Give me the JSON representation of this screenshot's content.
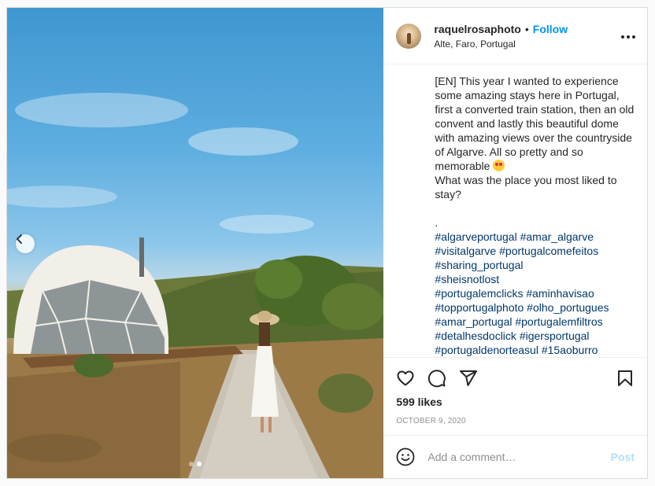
{
  "post": {
    "username": "raquelrosaphoto",
    "separator": "•",
    "follow_label": "Follow",
    "location": "Alte, Faro, Portugal",
    "more_icon": "more-options-icon",
    "caption": {
      "body": "[EN] This year I wanted to experience some amazing stays here in Portugal, first a converted train station, then an old convent and lastly this beautiful dome with amazing views over the countryside of Algarve. All so pretty and so memorable",
      "question": "What was the place you most liked to stay?",
      "dot": ".",
      "hashtags": [
        "#algarveportugal",
        "#amar_algarve",
        "#visitalgarve",
        "#portugalcomefeitos",
        "#sharing_portugal",
        "#sheisnotlost",
        "#portugalemclicks",
        "#aminhavisao",
        "#topportugalphoto",
        "#olho_portugues",
        "#amar_portugal",
        "#portugalemfiltros",
        "#detalhesdoclick",
        "#igersportugal",
        "#portugaldenorteasul",
        "#15aoburro"
      ]
    },
    "actions": {
      "like_icon": "heart-icon",
      "comment_icon": "comment-icon",
      "share_icon": "share-icon",
      "save_icon": "bookmark-icon"
    },
    "likes": "599 likes",
    "date": "OCTOBER 9, 2020",
    "comment": {
      "placeholder": "Add a comment…",
      "post_label": "Post"
    }
  },
  "colors": {
    "link": "#0095f6",
    "hashtag": "#00376b",
    "post_disabled": "#b2dffc"
  }
}
